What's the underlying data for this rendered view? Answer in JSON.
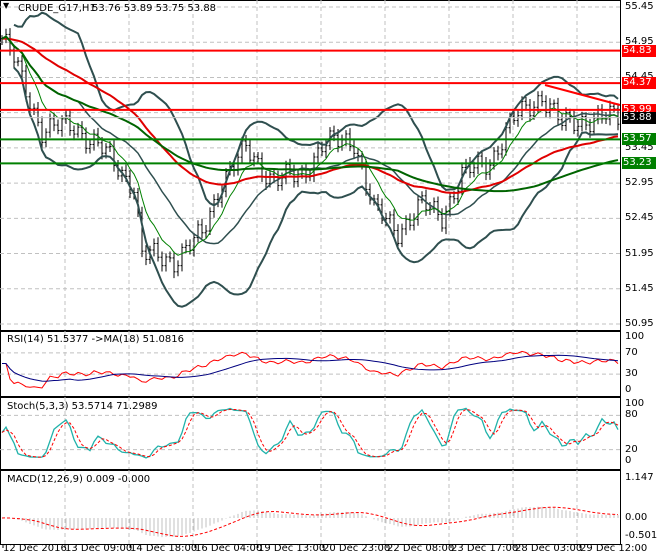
{
  "header": {
    "symbol": "CRUDE_G17,H1",
    "ohlc": "53.76 53.89 53.75 53.88"
  },
  "price_axis": [
    "55.45",
    "54.95",
    "54.45",
    "53.95",
    "53.45",
    "52.95",
    "52.45",
    "51.95",
    "51.45",
    "50.95"
  ],
  "levels": [
    {
      "value": "54.83",
      "color": "#ff0000"
    },
    {
      "value": "54.37",
      "color": "#ff0000"
    },
    {
      "value": "53.99",
      "color": "#ff0000"
    },
    {
      "value": "53.57",
      "color": "#008000"
    },
    {
      "value": "53.23",
      "color": "#008000"
    }
  ],
  "current_price": "53.88",
  "rsi": {
    "label": "RSI(14) 51.5377  ->MA(18) 51.0816",
    "ticks": [
      "100",
      "70",
      "30",
      "0"
    ]
  },
  "stoch": {
    "label": "Stoch(5,3,3) 53.5714 71.2989",
    "ticks": [
      "100",
      "80",
      "20",
      "0"
    ]
  },
  "macd": {
    "label": "MACD(12,26,9) 0.009 -0.000",
    "ticks": [
      "1.147",
      "0.00",
      "-0.501"
    ]
  },
  "time_axis": [
    "12 Dec 2016",
    "13 Dec 09:00",
    "14 Dec 18:00",
    "16 Dec 04:00",
    "19 Dec 13:00",
    "20 Dec 23:00",
    "22 Dec 08:00",
    "23 Dec 17:00",
    "28 Dec 03:00",
    "29 Dec 12:00"
  ],
  "chart_data": {
    "type": "line",
    "title": "CRUDE_G17,H1",
    "ylim": [
      50.95,
      55.45
    ],
    "anchor_bar": [
      0,
      3,
      10,
      18,
      25,
      33,
      35,
      43,
      50,
      55,
      61,
      68,
      75,
      80,
      88,
      93,
      99,
      105,
      110,
      115,
      122,
      128,
      135,
      140,
      145,
      152
    ],
    "anchor_close": [
      55.0,
      54.7,
      53.7,
      53.77,
      53.42,
      52.92,
      51.93,
      51.86,
      52.21,
      52.99,
      53.42,
      52.99,
      53.06,
      53.49,
      53.56,
      52.56,
      52.28,
      52.63,
      52.49,
      53.06,
      53.27,
      53.85,
      54.2,
      53.77,
      53.85,
      53.88
    ]
  }
}
